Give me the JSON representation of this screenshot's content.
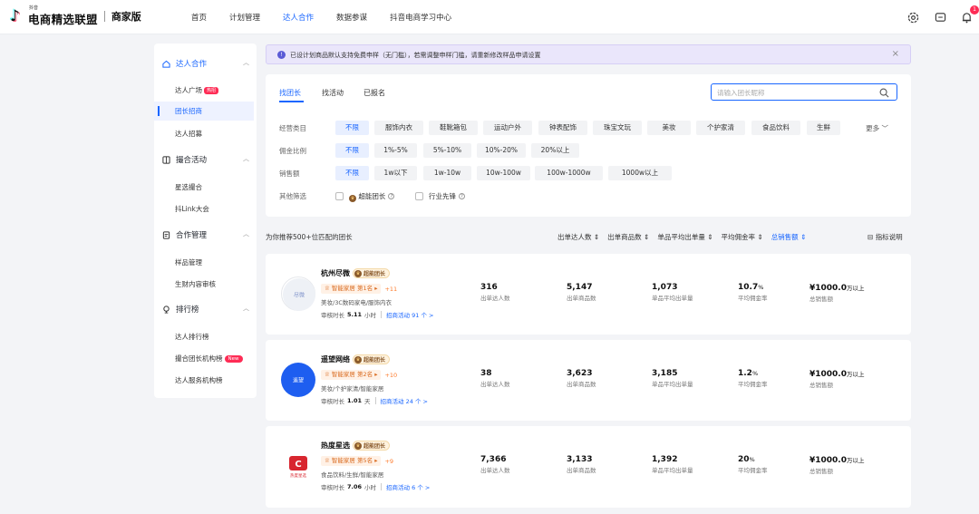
{
  "header": {
    "logo_small": "抖音",
    "logo_main": "电商精选联盟",
    "logo_tag": "商家版",
    "nav": [
      "首页",
      "计划管理",
      "达人合作",
      "数据参谋",
      "抖音电商学习中心"
    ],
    "notif_count": "1"
  },
  "sidebar": {
    "groups": [
      {
        "label": "达人合作",
        "items": [
          {
            "label": "达人广场",
            "tag": "热招"
          },
          {
            "label": "团长招商"
          },
          {
            "label": "达人招募"
          }
        ]
      },
      {
        "label": "撮合活动",
        "items": [
          {
            "label": "星选撮合"
          },
          {
            "label": "抖Link大会"
          }
        ]
      },
      {
        "label": "合作管理",
        "items": [
          {
            "label": "样品管理"
          },
          {
            "label": "生财内容审核"
          }
        ]
      },
      {
        "label": "排行榜",
        "items": [
          {
            "label": "达人排行榜"
          },
          {
            "label": "撮合团长机构榜",
            "tag": "New"
          },
          {
            "label": "达人服务机构榜"
          }
        ]
      }
    ]
  },
  "notice": {
    "text": "已设计划商品默认支持免费申样（无门槛），若需调整申样门槛，请重新修改样品申请设置",
    "close": "×"
  },
  "filter": {
    "tabs": [
      "找团长",
      "找活动",
      "已报名"
    ],
    "search_placeholder": "请输入团长昵称",
    "rows": [
      {
        "label": "经营类目",
        "chips": [
          "不限",
          "服饰内衣",
          "鞋靴箱包",
          "运动户外",
          "钟表配饰",
          "珠宝文玩",
          "美妆",
          "个护家清",
          "食品饮料",
          "生鲜"
        ],
        "more": "更多"
      },
      {
        "label": "佣金比例",
        "chips": [
          "不限",
          "1%-5%",
          "5%-10%",
          "10%-20%",
          "20%以上"
        ]
      },
      {
        "label": "销售额",
        "chips": [
          "不限",
          "1w以下",
          "1w-10w",
          "10w-100w",
          "100w-1000w",
          "1000w以上"
        ]
      }
    ],
    "other_label": "其他筛选",
    "opt1": "超能团长",
    "opt2": "行业先锋"
  },
  "list": {
    "recommend": "为你推荐500+位匹配的团长",
    "sorts": [
      "出单达人数 ⇕",
      "出单商品数 ⇕",
      "单品平均出单量 ⇕",
      "平均佣金率 ⇕",
      "总销售额 ⇕"
    ],
    "indicator": "指标说明",
    "stat_labels": [
      "出单达人数",
      "出单商品数",
      "单品平均出单量",
      "平均佣金率",
      "总销售额"
    ],
    "cards": [
      {
        "name": "杭州尽微",
        "super": "超能团长",
        "rank": "智能家居 第1名",
        "delta": "+11",
        "cats": "美妆/3C数码家电/服饰内衣",
        "audit_label": "审核时长",
        "audit_val": "5.11",
        "audit_unit": "小时",
        "activity": "招商活动 91 个 >",
        "v1": "316",
        "v2": "5,147",
        "v3": "1,073",
        "v4": "10.7",
        "v4u": "%",
        "v5": "¥1000.0",
        "v5u": "万以上",
        "avatar_text": "尽微",
        "avatar_bg": "#eef1f6",
        "avatar_fg": "#7b8fc9"
      },
      {
        "name": "遥望网络",
        "super": "超能团长",
        "rank": "智能家居 第2名",
        "delta": "+10",
        "cats": "美妆/个护家清/智能家居",
        "audit_label": "审核时长",
        "audit_val": "1.01",
        "audit_unit": "天",
        "activity": "招商活动 24 个 >",
        "v1": "38",
        "v2": "3,623",
        "v3": "3,185",
        "v4": "1.2",
        "v4u": "%",
        "v5": "¥1000.0",
        "v5u": "万以上",
        "avatar_text": "遥望",
        "avatar_bg": "#1e5ef0",
        "avatar_fg": "#ffffff"
      },
      {
        "name": "热度星选",
        "super": "超能团长",
        "rank": "智能家居 第5名",
        "delta": "+9",
        "cats": "食品饮料/生鲜/智能家居",
        "audit_label": "审核时长",
        "audit_val": "7.06",
        "audit_unit": "小时",
        "activity": "招商活动 6 个 >",
        "v1": "7,366",
        "v2": "3,133",
        "v3": "1,392",
        "v4": "20",
        "v4u": "%",
        "v5": "¥1000.0",
        "v5u": "万以上",
        "avatar_text": "热度星选",
        "avatar_bg": "#ffffff",
        "avatar_fg": "#d8262f"
      }
    ]
  }
}
